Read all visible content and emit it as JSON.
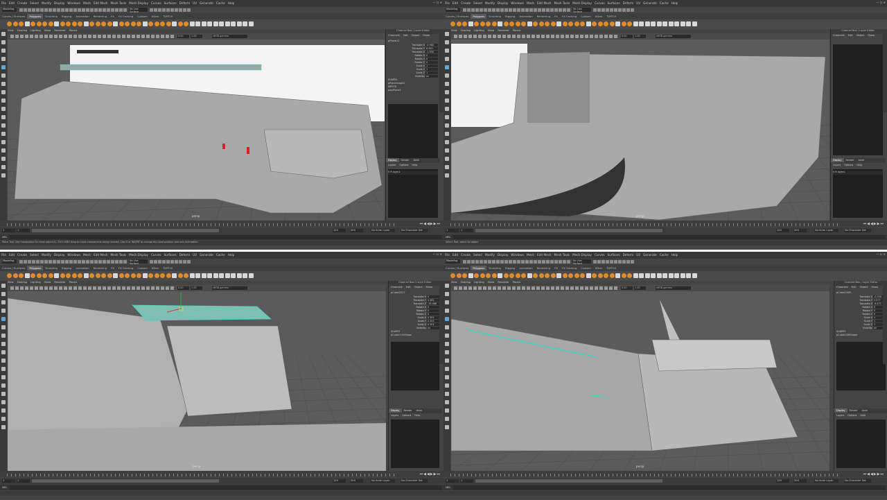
{
  "menu_primary": [
    "File",
    "Edit",
    "Create",
    "Select",
    "Modify",
    "Display",
    "Windows",
    "Mesh",
    "Edit Mesh",
    "Mesh Tools",
    "Mesh Display",
    "Curves",
    "Surfaces",
    "Deform",
    "UV",
    "Generate",
    "Cache",
    "Help"
  ],
  "mode": "Modeling",
  "live_surface": "No Live Surface",
  "shelf_tabs": [
    "Curves / Surfaces",
    "Polygons",
    "Sculpting",
    "Rigging",
    "Animation",
    "Rendering",
    "FX",
    "FX Caching",
    "Custom",
    "XGen",
    "TURTLE"
  ],
  "shelf_active": "Polygons",
  "panel_menu": [
    "View",
    "Shading",
    "Lighting",
    "Show",
    "Renderer",
    "Panels"
  ],
  "gamma": "sRGB gamma",
  "field_a": "0.00",
  "field_b": "1.00",
  "camera": "persp",
  "channel_box": {
    "title": "Channel Box / Layer Editor",
    "menu": [
      "Channels",
      "Edit",
      "Object",
      "Show"
    ],
    "attrs": [
      "Translate X",
      "Translate Y",
      "Translate Z",
      "Rotate X",
      "Rotate Y",
      "Rotate Z",
      "Scale X",
      "Scale Y",
      "Scale Z",
      "Visibility"
    ],
    "shapes_label": "SHAPES",
    "inputs_label": "INPUTS"
  },
  "layer_tabs": [
    "Display",
    "Render",
    "Anim"
  ],
  "layer_menu": [
    "Layers",
    "Options",
    "Help"
  ],
  "layer_name": "layer1",
  "range": {
    "start": "1",
    "end_inner": "120",
    "end_a": "120",
    "end_b": "200"
  },
  "no_anim_layer": "No Anim Layer",
  "no_char_set": "No Character Set",
  "mel": "MEL",
  "views": [
    {
      "object": "pPlane11",
      "values": [
        "-0.980",
        "6.950",
        "-1.950",
        "0",
        "0",
        "0",
        "1",
        "1",
        "1",
        "on"
      ],
      "shape": "pPlaneShape2",
      "input": "polyPlane2",
      "help": "Move Tool: Use manipulator to move object(s). Ctrl+LMB+drag to move components along normals. Use D or INSERT to change the pivot position and axis orientation.",
      "banner_text": "C. ZELAKI LIMMAFAS | 2020",
      "show_layers": true
    },
    {
      "object": "",
      "values": [],
      "shape": "",
      "input": "",
      "help": "Select Tool: select an object",
      "banner_text": "NCESS OF THE ORIENT",
      "banner_sub": "CEDU",
      "show_layers": true
    },
    {
      "object": "pCube2017",
      "values": [
        "0",
        "5.381",
        "-15.468",
        "0",
        "0",
        "0",
        "0.301",
        "0.301",
        "0.301",
        "on"
      ],
      "shape": "pCube2170Shape",
      "input": "",
      "help": "",
      "show_layers": false
    },
    {
      "object": "pCube2108...",
      "values": [
        "-0.058",
        "5.577",
        "-8.471",
        "0",
        "0",
        "0",
        "1",
        "1",
        "1",
        "on"
      ],
      "shape": "pCube2108Shape",
      "input": "",
      "help": "",
      "show_layers": false
    }
  ],
  "colors": {
    "accent": "#5aa7d8",
    "shelf_icon": "#e08a2a",
    "selection": "#3ad6c0",
    "hull": "#a9a9a9"
  }
}
